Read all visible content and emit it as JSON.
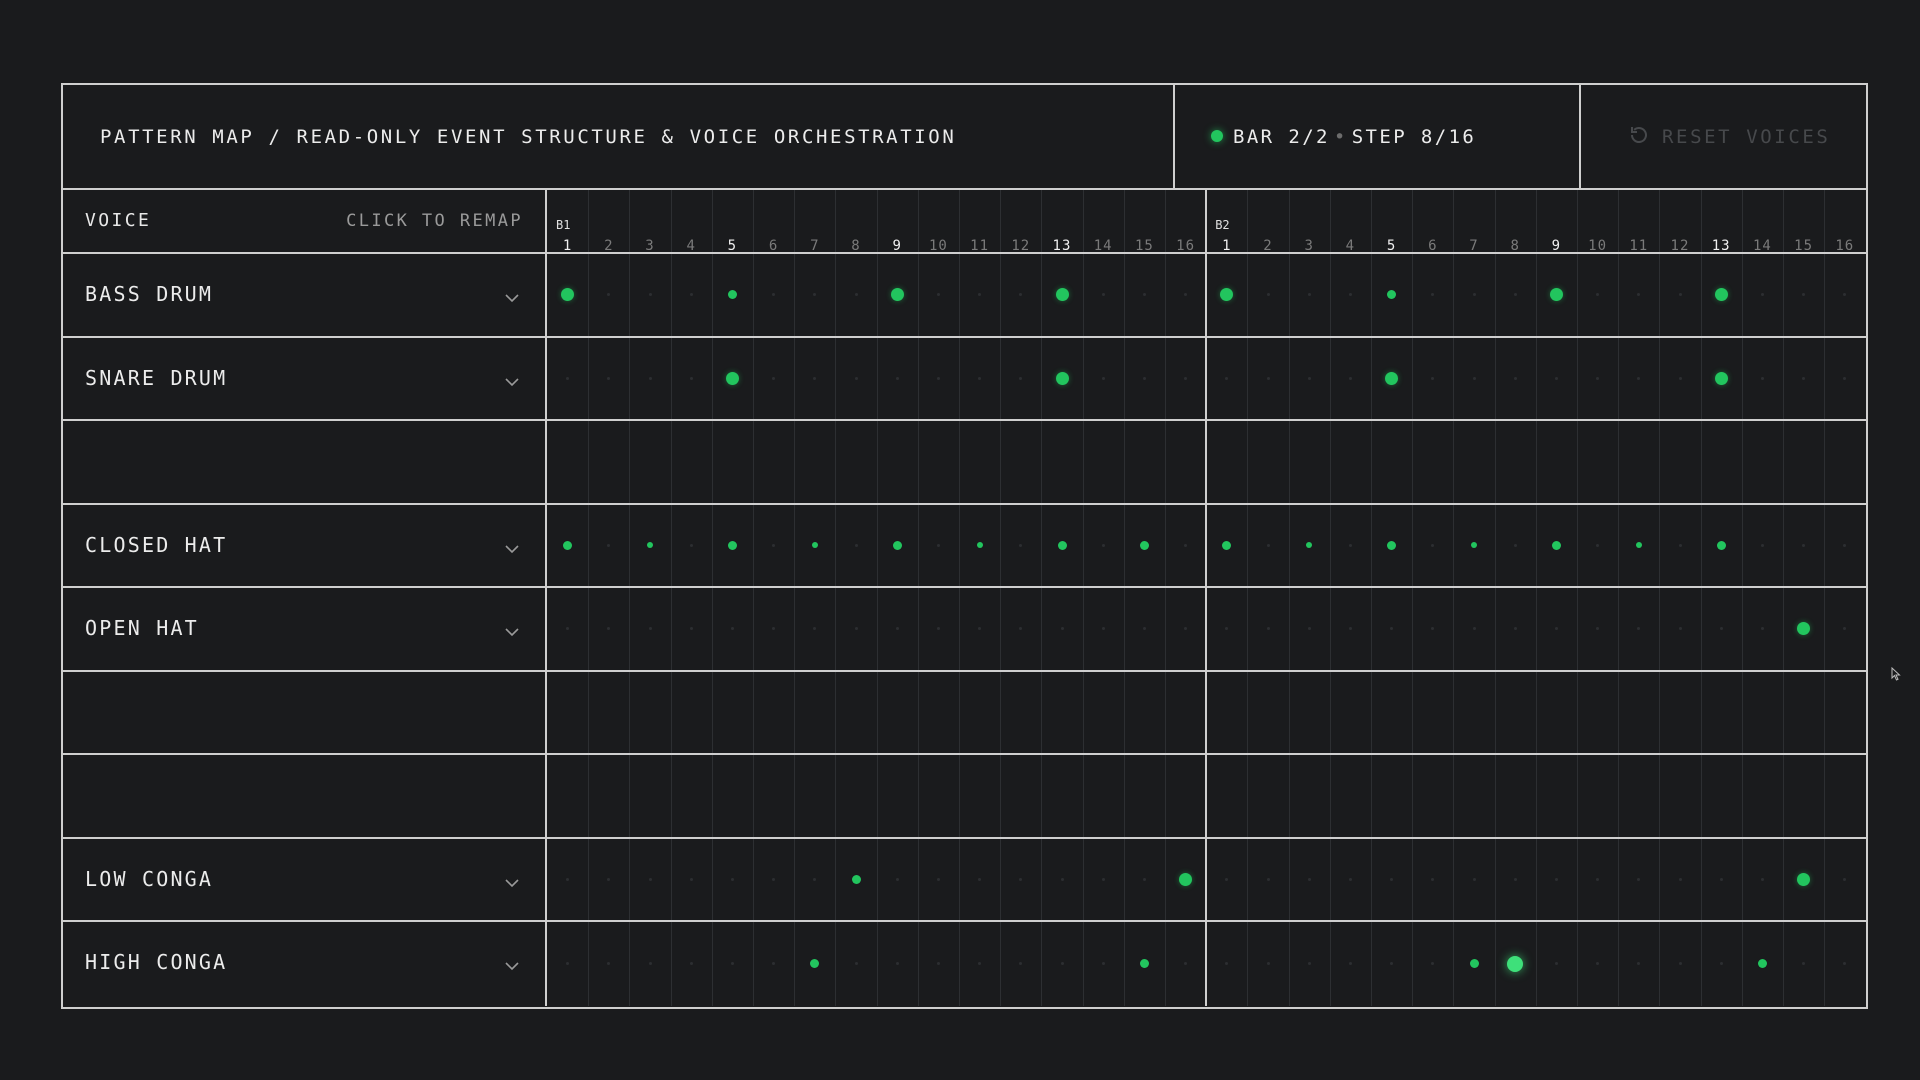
{
  "header": {
    "title": "PATTERN MAP / READ-ONLY EVENT STRUCTURE & VOICE ORCHESTRATION",
    "bar_text": "BAR 2/2",
    "step_text": "STEP 8/16",
    "reset_label": "RESET VOICES",
    "reset_icon": "reset-icon",
    "status_color": "#22c55e"
  },
  "columns": {
    "voice_label": "VOICE",
    "remap_label": "CLICK TO REMAP"
  },
  "bars": [
    {
      "label": "B1",
      "steps": [
        "1",
        "2",
        "3",
        "4",
        "5",
        "6",
        "7",
        "8",
        "9",
        "10",
        "11",
        "12",
        "13",
        "14",
        "15",
        "16"
      ]
    },
    {
      "label": "B2",
      "steps": [
        "1",
        "2",
        "3",
        "4",
        "5",
        "6",
        "7",
        "8",
        "9",
        "10",
        "11",
        "12",
        "13",
        "14",
        "15",
        "16"
      ]
    }
  ],
  "accent_color": "#22c55e",
  "current_step": 24,
  "voices": [
    {
      "name": "BASS DRUM",
      "events": [
        {
          "s": 1,
          "v": 3
        },
        {
          "s": 5,
          "v": 2
        },
        {
          "s": 9,
          "v": 3
        },
        {
          "s": 13,
          "v": 3
        },
        {
          "s": 17,
          "v": 3
        },
        {
          "s": 21,
          "v": 2
        },
        {
          "s": 25,
          "v": 3
        },
        {
          "s": 29,
          "v": 3
        }
      ]
    },
    {
      "name": "SNARE DRUM",
      "events": [
        {
          "s": 5,
          "v": 3
        },
        {
          "s": 13,
          "v": 3
        },
        {
          "s": 21,
          "v": 3
        },
        {
          "s": 29,
          "v": 3
        }
      ]
    },
    {
      "name": "",
      "events": []
    },
    {
      "name": "CLOSED HAT",
      "events": [
        {
          "s": 1,
          "v": 2
        },
        {
          "s": 3,
          "v": 1
        },
        {
          "s": 5,
          "v": 2
        },
        {
          "s": 7,
          "v": 1
        },
        {
          "s": 9,
          "v": 2
        },
        {
          "s": 11,
          "v": 1
        },
        {
          "s": 13,
          "v": 2
        },
        {
          "s": 15,
          "v": 2
        },
        {
          "s": 17,
          "v": 2
        },
        {
          "s": 19,
          "v": 1
        },
        {
          "s": 21,
          "v": 2
        },
        {
          "s": 23,
          "v": 1
        },
        {
          "s": 25,
          "v": 2
        },
        {
          "s": 27,
          "v": 1
        },
        {
          "s": 29,
          "v": 2
        }
      ]
    },
    {
      "name": "OPEN HAT",
      "events": [
        {
          "s": 31,
          "v": 3
        }
      ]
    },
    {
      "name": "",
      "events": []
    },
    {
      "name": "",
      "events": []
    },
    {
      "name": "LOW CONGA",
      "events": [
        {
          "s": 8,
          "v": 2
        },
        {
          "s": 16,
          "v": 3
        },
        {
          "s": 31,
          "v": 3
        }
      ]
    },
    {
      "name": "HIGH CONGA",
      "events": [
        {
          "s": 7,
          "v": 2
        },
        {
          "s": 15,
          "v": 2
        },
        {
          "s": 23,
          "v": 2
        },
        {
          "s": 24,
          "v": 4
        },
        {
          "s": 30,
          "v": 2
        }
      ]
    }
  ]
}
